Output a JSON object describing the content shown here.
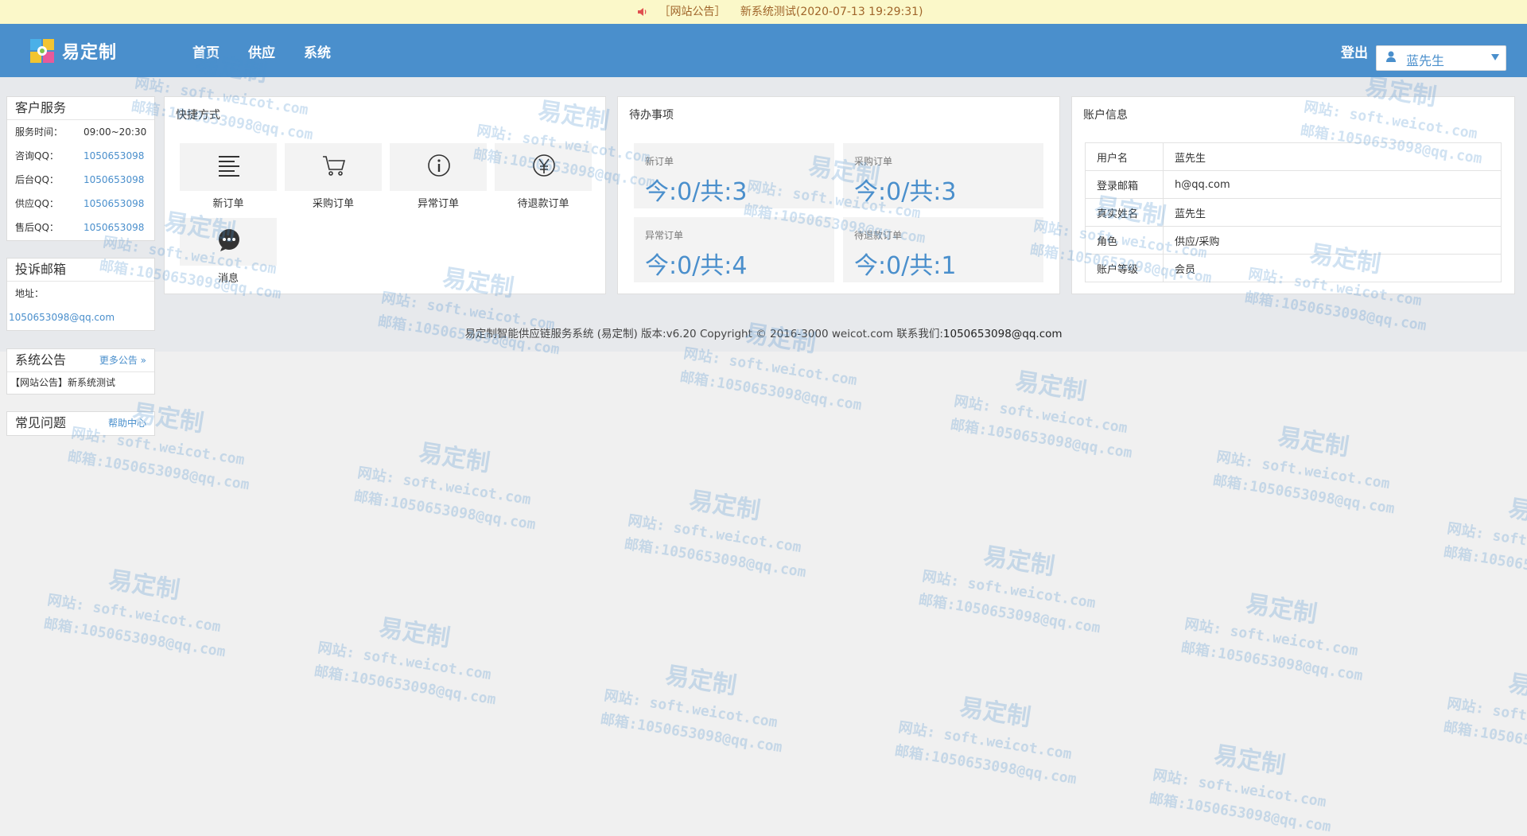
{
  "notice": {
    "tag": "［网站公告］",
    "text": "新系统测试(2020-07-13 19:29:31)"
  },
  "header": {
    "logo_text": "易定制",
    "nav": [
      "首页",
      "供应",
      "系统"
    ],
    "logout": "登出",
    "user": "蓝先生"
  },
  "sidebar": {
    "service": {
      "title": "客户服务",
      "rows": [
        {
          "k": "服务时间：",
          "v": "09:00~20:30"
        },
        {
          "k": "咨询QQ：",
          "v": "1050653098"
        },
        {
          "k": "后台QQ：",
          "v": "1050653098"
        },
        {
          "k": "供应QQ：",
          "v": "1050653098"
        },
        {
          "k": "售后QQ：",
          "v": "1050653098"
        }
      ]
    },
    "complaint": {
      "title": "投诉邮箱",
      "address_label": "地址：",
      "email": "1050653098@qq.com"
    },
    "announce": {
      "title": "系统公告",
      "more": "更多公告",
      "item": "【网站公告】新系统测试"
    },
    "faq": {
      "title": "常见问题",
      "more": "帮助中心"
    }
  },
  "shortcuts": {
    "title": "快捷方式",
    "items": [
      {
        "label": "新订单",
        "icon": "list-icon"
      },
      {
        "label": "采购订单",
        "icon": "cart-icon"
      },
      {
        "label": "异常订单",
        "icon": "info-icon"
      },
      {
        "label": "待退款订单",
        "icon": "yen-icon"
      },
      {
        "label": "消息",
        "icon": "chat-icon"
      }
    ]
  },
  "todo": {
    "title": "待办事项",
    "items": [
      {
        "title": "新订单",
        "value": "今:0/共:3"
      },
      {
        "title": "采购订单",
        "value": "今:0/共:3"
      },
      {
        "title": "异常订单",
        "value": "今:0/共:4"
      },
      {
        "title": "待退款订单",
        "value": "今:0/共:1"
      }
    ]
  },
  "account": {
    "title": "账户信息",
    "rows": [
      {
        "k": "用户名",
        "v": "蓝先生"
      },
      {
        "k": "登录邮箱",
        "v": "h@qq.com"
      },
      {
        "k": "真实姓名",
        "v": "蓝先生"
      },
      {
        "k": "角色",
        "v": "供应/采购"
      },
      {
        "k": "账户等级",
        "v": "会员"
      }
    ]
  },
  "footer": {
    "text": "易定制智能供应链服务系统 (易定制) 版本:v6.20 Copyright © 2016-3000 weicot.com 联系我们:",
    "contact": "1050653098@qq.com"
  },
  "watermark": {
    "brand": "易定制",
    "site": "网站: soft.weicot.com",
    "email": "邮箱:1050653098@qq.com"
  },
  "colors": {
    "header": "#4a8fcc",
    "notice_bg": "#fbf8c9",
    "accent": "#4a8fcc"
  }
}
